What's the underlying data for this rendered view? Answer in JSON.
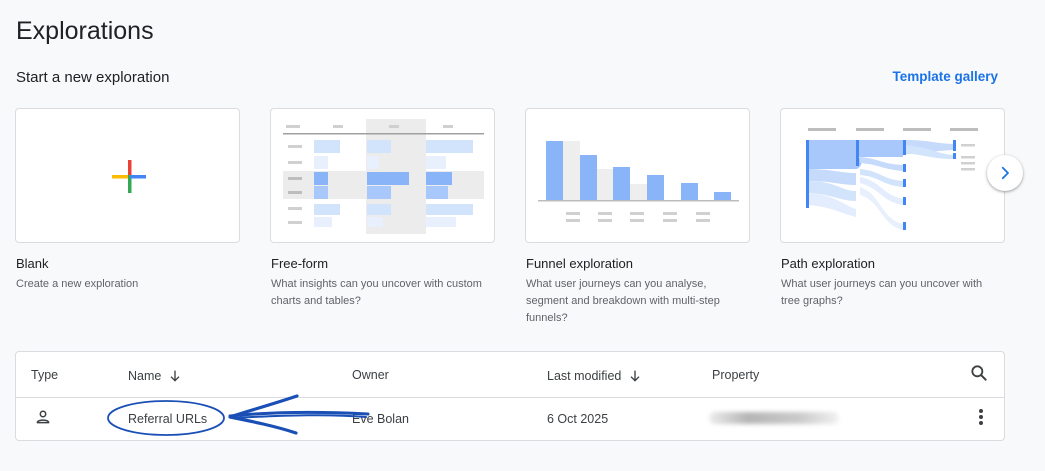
{
  "page": {
    "title": "Explorations",
    "section_title": "Start a new exploration",
    "template_gallery": "Template gallery"
  },
  "templates": [
    {
      "label": "Blank",
      "desc": "Create a new exploration"
    },
    {
      "label": "Free-form",
      "desc": "What insights can you uncover with custom charts and tables?"
    },
    {
      "label": "Funnel exploration",
      "desc": "What user journeys can you analyse, segment and breakdown with multi-step funnels?"
    },
    {
      "label": "Path exploration",
      "desc": "What user journeys can you uncover with tree graphs?"
    }
  ],
  "table": {
    "headers": {
      "type": "Type",
      "name": "Name",
      "owner": "Owner",
      "last_modified": "Last modified",
      "property": "Property"
    },
    "rows": [
      {
        "type_icon": "person-icon",
        "name": "Referral URLs",
        "owner": "Eve Bolan",
        "last_modified": "6 Oct 2025",
        "property": ""
      }
    ]
  },
  "colors": {
    "accent": "#1a73e8",
    "chart_blue": "#8ab4f8",
    "chart_blue_dark": "#4285f4",
    "annotation": "#1a4fb5"
  },
  "icons": {
    "next": "chevron-right-icon",
    "search": "search-icon",
    "more": "more-vert-icon",
    "sort": "arrow-down-icon",
    "blank": "google-plus-icon"
  }
}
